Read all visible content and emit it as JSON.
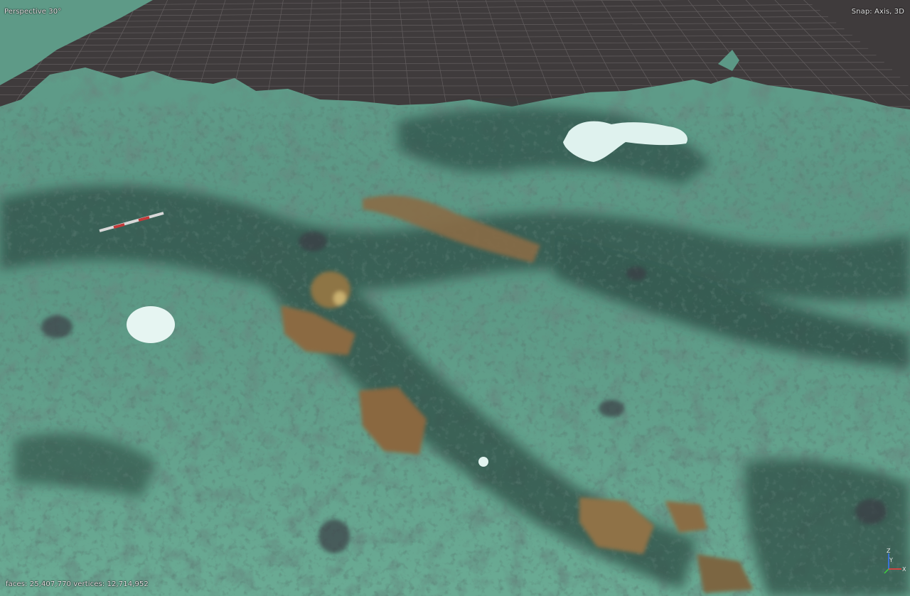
{
  "viewport": {
    "view_label": "Perspective 30°",
    "snap_label": "Snap: Axis, 3D",
    "stats_label": "faces: 25,407,770 vertices: 12,714,952"
  },
  "gizmo": {
    "z_label": "Z",
    "y_label": "Y",
    "x_label": "X",
    "z_color": "#3a78ff",
    "y_color": "#3ecf3e",
    "x_color": "#ff3a3a"
  },
  "colors": {
    "background": "#3f3b3c",
    "grid": "#6a6566",
    "seafloor": "#6aa893",
    "reef_dark": "#2c4f45",
    "sponge": "#8a7046",
    "coral_white": "#dff2ee"
  }
}
